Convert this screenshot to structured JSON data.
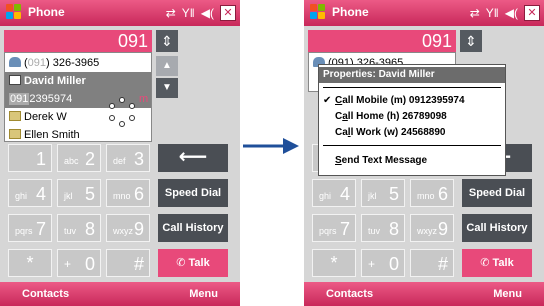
{
  "left": {
    "title": "Phone",
    "number": "091",
    "list": [
      {
        "text_prefix": "(",
        "text_hl": "091",
        "text_suffix": ") 326-3965"
      },
      {
        "name": "David Miller"
      },
      {
        "text_hl": "091",
        "text_rest": "2395974"
      },
      {
        "name": "Derek W"
      },
      {
        "name": "Ellen Smith"
      }
    ],
    "list_marker": "m",
    "softkeys": {
      "left": "Contacts",
      "right": "Menu"
    }
  },
  "right": {
    "title": "Phone",
    "number": "091",
    "list_peek": "(091) 326-3965",
    "menu": {
      "header": "Properties: David Miller",
      "items": [
        {
          "accel": "C",
          "rest": "all Mobile (m) 0912395974",
          "checked": true
        },
        {
          "pre": "C",
          "accel": "a",
          "rest": "ll Home (h) 26789098"
        },
        {
          "pre": "Ca",
          "accel": "l",
          "rest": "l Work (w) 24568890"
        },
        {
          "accel": "S",
          "rest": "end Text Message"
        }
      ]
    },
    "softkeys": {
      "left": "Contacts",
      "right": "Menu"
    }
  },
  "keypad": {
    "keys": [
      {
        "sub": "",
        "digit": "1"
      },
      {
        "sub": "abc",
        "digit": "2"
      },
      {
        "sub": "def",
        "digit": "3"
      },
      {
        "sub": "ghi",
        "digit": "4"
      },
      {
        "sub": "jkl",
        "digit": "5"
      },
      {
        "sub": "mno",
        "digit": "6"
      },
      {
        "sub": "pqrs",
        "digit": "7"
      },
      {
        "sub": "tuv",
        "digit": "8"
      },
      {
        "sub": "wxyz",
        "digit": "9"
      },
      {
        "sub": "",
        "digit": "*"
      },
      {
        "sub": "+",
        "digit": "0"
      },
      {
        "sub": "",
        "digit": "#"
      }
    ],
    "speed_dial": "Speed Dial",
    "call_history": "Call History",
    "talk": "Talk"
  },
  "colors": {
    "accent": "#e8497a",
    "dark_button": "#4a4e54",
    "arrow": "#1f4f9a"
  }
}
